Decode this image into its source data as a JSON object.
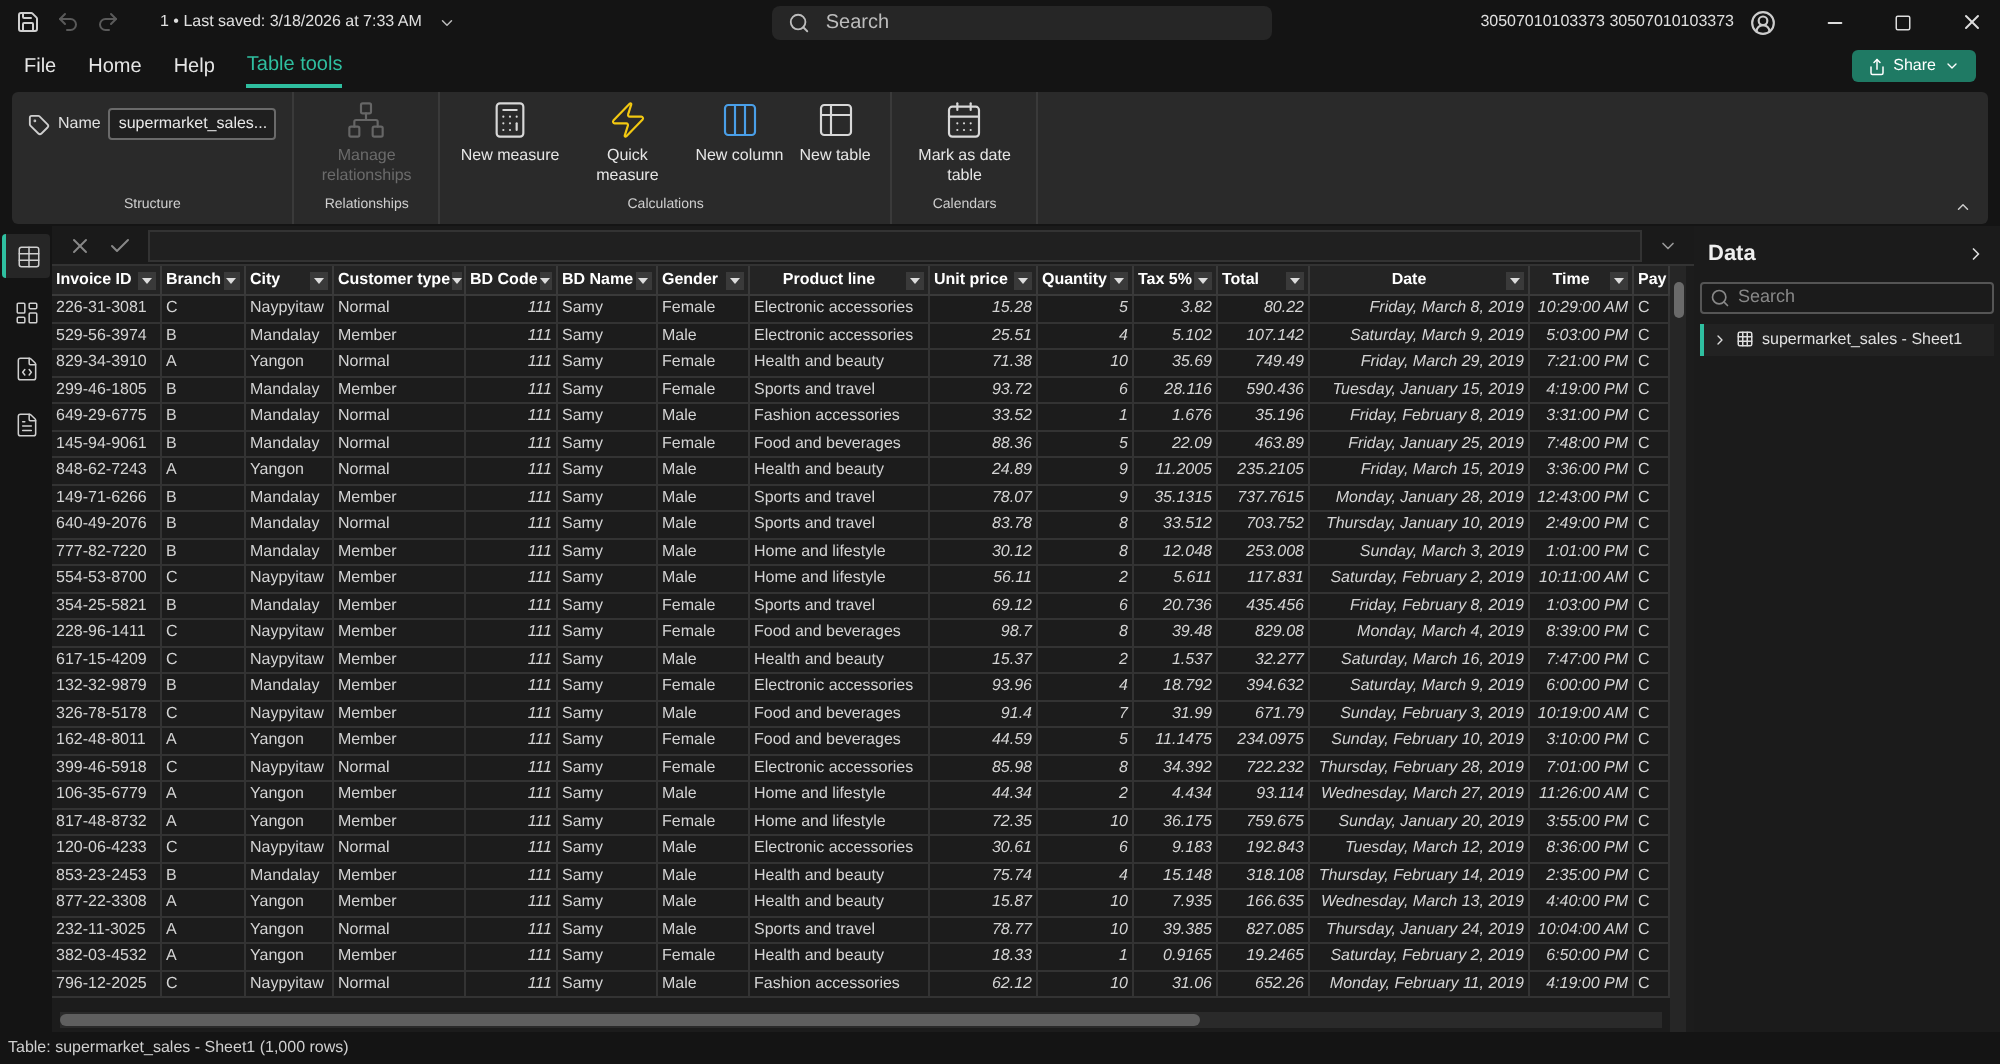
{
  "title_bar": {
    "title": "1 • Last saved: 3/18/2026 at 7:33 AM",
    "search": {
      "placeholder": "Search"
    },
    "user": "30507010103373 30507010103373",
    "quick_access": [
      {
        "disabled": false
      },
      {
        "disabled": true
      },
      {
        "disabled": true
      }
    ]
  },
  "menu": [
    {
      "label": "File",
      "selected": false
    },
    {
      "label": "Home",
      "selected": false
    },
    {
      "label": "Help",
      "selected": false
    },
    {
      "label": "Table tools",
      "selected": true
    }
  ],
  "share_button": "Share",
  "ribbon": {
    "groups": [
      {
        "label": "Structure",
        "name_field": {
          "label": "Name",
          "value": "supermarket_sales..."
        }
      },
      {
        "label": "Relationships",
        "buttons": [
          {
            "label": "Manage relationships",
            "disabled": true
          }
        ]
      },
      {
        "label": "Calculations",
        "buttons": [
          {
            "label": "New measure",
            "disabled": false
          },
          {
            "label": "Quick measure",
            "disabled": false
          },
          {
            "label": "New column",
            "disabled": false
          },
          {
            "label": "New table",
            "disabled": false
          }
        ]
      },
      {
        "label": "Calendars",
        "buttons": [
          {
            "label": "Mark as date table",
            "disabled": false
          }
        ]
      }
    ]
  },
  "view_rail": [
    {
      "selected": true
    },
    {
      "selected": false
    },
    {
      "selected": false
    },
    {
      "selected": false
    }
  ],
  "table": {
    "columns": [
      {
        "label": "Invoice ID",
        "kind": "text"
      },
      {
        "label": "Branch",
        "kind": "text"
      },
      {
        "label": "City",
        "kind": "text"
      },
      {
        "label": "Customer type",
        "kind": "text"
      },
      {
        "label": "BD Code",
        "kind": "number"
      },
      {
        "label": "BD Name",
        "kind": "text"
      },
      {
        "label": "Gender",
        "kind": "text"
      },
      {
        "label": "Product line",
        "kind": "text"
      },
      {
        "label": "Unit price",
        "kind": "number"
      },
      {
        "label": "Quantity",
        "kind": "number"
      },
      {
        "label": "Tax 5%",
        "kind": "number"
      },
      {
        "label": "Total",
        "kind": "number"
      },
      {
        "label": "Date",
        "kind": "number"
      },
      {
        "label": "Time",
        "kind": "number"
      },
      {
        "label": "Pay",
        "kind": "cut"
      }
    ],
    "rows": [
      [
        "226-31-3081",
        "C",
        "Naypyitaw",
        "Normal",
        "111",
        "Samy",
        "Female",
        "Electronic accessories",
        "15.28",
        "5",
        "3.82",
        "80.22",
        "Friday, March 8, 2019",
        "10:29:00 AM",
        "C"
      ],
      [
        "529-56-3974",
        "B",
        "Mandalay",
        "Member",
        "111",
        "Samy",
        "Male",
        "Electronic accessories",
        "25.51",
        "4",
        "5.102",
        "107.142",
        "Saturday, March 9, 2019",
        "5:03:00 PM",
        "C"
      ],
      [
        "829-34-3910",
        "A",
        "Yangon",
        "Normal",
        "111",
        "Samy",
        "Female",
        "Health and beauty",
        "71.38",
        "10",
        "35.69",
        "749.49",
        "Friday, March 29, 2019",
        "7:21:00 PM",
        "C"
      ],
      [
        "299-46-1805",
        "B",
        "Mandalay",
        "Member",
        "111",
        "Samy",
        "Female",
        "Sports and travel",
        "93.72",
        "6",
        "28.116",
        "590.436",
        "Tuesday, January 15, 2019",
        "4:19:00 PM",
        "C"
      ],
      [
        "649-29-6775",
        "B",
        "Mandalay",
        "Normal",
        "111",
        "Samy",
        "Male",
        "Fashion accessories",
        "33.52",
        "1",
        "1.676",
        "35.196",
        "Friday, February 8, 2019",
        "3:31:00 PM",
        "C"
      ],
      [
        "145-94-9061",
        "B",
        "Mandalay",
        "Normal",
        "111",
        "Samy",
        "Female",
        "Food and beverages",
        "88.36",
        "5",
        "22.09",
        "463.89",
        "Friday, January 25, 2019",
        "7:48:00 PM",
        "C"
      ],
      [
        "848-62-7243",
        "A",
        "Yangon",
        "Normal",
        "111",
        "Samy",
        "Male",
        "Health and beauty",
        "24.89",
        "9",
        "11.2005",
        "235.2105",
        "Friday, March 15, 2019",
        "3:36:00 PM",
        "C"
      ],
      [
        "149-71-6266",
        "B",
        "Mandalay",
        "Member",
        "111",
        "Samy",
        "Male",
        "Sports and travel",
        "78.07",
        "9",
        "35.1315",
        "737.7615",
        "Monday, January 28, 2019",
        "12:43:00 PM",
        "C"
      ],
      [
        "640-49-2076",
        "B",
        "Mandalay",
        "Normal",
        "111",
        "Samy",
        "Male",
        "Sports and travel",
        "83.78",
        "8",
        "33.512",
        "703.752",
        "Thursday, January 10, 2019",
        "2:49:00 PM",
        "C"
      ],
      [
        "777-82-7220",
        "B",
        "Mandalay",
        "Member",
        "111",
        "Samy",
        "Male",
        "Home and lifestyle",
        "30.12",
        "8",
        "12.048",
        "253.008",
        "Sunday, March 3, 2019",
        "1:01:00 PM",
        "C"
      ],
      [
        "554-53-8700",
        "C",
        "Naypyitaw",
        "Member",
        "111",
        "Samy",
        "Male",
        "Home and lifestyle",
        "56.11",
        "2",
        "5.611",
        "117.831",
        "Saturday, February 2, 2019",
        "10:11:00 AM",
        "C"
      ],
      [
        "354-25-5821",
        "B",
        "Mandalay",
        "Member",
        "111",
        "Samy",
        "Female",
        "Sports and travel",
        "69.12",
        "6",
        "20.736",
        "435.456",
        "Friday, February 8, 2019",
        "1:03:00 PM",
        "C"
      ],
      [
        "228-96-1411",
        "C",
        "Naypyitaw",
        "Member",
        "111",
        "Samy",
        "Female",
        "Food and beverages",
        "98.7",
        "8",
        "39.48",
        "829.08",
        "Monday, March 4, 2019",
        "8:39:00 PM",
        "C"
      ],
      [
        "617-15-4209",
        "C",
        "Naypyitaw",
        "Member",
        "111",
        "Samy",
        "Male",
        "Health and beauty",
        "15.37",
        "2",
        "1.537",
        "32.277",
        "Saturday, March 16, 2019",
        "7:47:00 PM",
        "C"
      ],
      [
        "132-32-9879",
        "B",
        "Mandalay",
        "Member",
        "111",
        "Samy",
        "Female",
        "Electronic accessories",
        "93.96",
        "4",
        "18.792",
        "394.632",
        "Saturday, March 9, 2019",
        "6:00:00 PM",
        "C"
      ],
      [
        "326-78-5178",
        "C",
        "Naypyitaw",
        "Member",
        "111",
        "Samy",
        "Male",
        "Food and beverages",
        "91.4",
        "7",
        "31.99",
        "671.79",
        "Sunday, February 3, 2019",
        "10:19:00 AM",
        "C"
      ],
      [
        "162-48-8011",
        "A",
        "Yangon",
        "Member",
        "111",
        "Samy",
        "Female",
        "Food and beverages",
        "44.59",
        "5",
        "11.1475",
        "234.0975",
        "Sunday, February 10, 2019",
        "3:10:00 PM",
        "C"
      ],
      [
        "399-46-5918",
        "C",
        "Naypyitaw",
        "Normal",
        "111",
        "Samy",
        "Female",
        "Electronic accessories",
        "85.98",
        "8",
        "34.392",
        "722.232",
        "Thursday, February 28, 2019",
        "7:01:00 PM",
        "C"
      ],
      [
        "106-35-6779",
        "A",
        "Yangon",
        "Member",
        "111",
        "Samy",
        "Male",
        "Home and lifestyle",
        "44.34",
        "2",
        "4.434",
        "93.114",
        "Wednesday, March 27, 2019",
        "11:26:00 AM",
        "C"
      ],
      [
        "817-48-8732",
        "A",
        "Yangon",
        "Member",
        "111",
        "Samy",
        "Female",
        "Home and lifestyle",
        "72.35",
        "10",
        "36.175",
        "759.675",
        "Sunday, January 20, 2019",
        "3:55:00 PM",
        "C"
      ],
      [
        "120-06-4233",
        "C",
        "Naypyitaw",
        "Normal",
        "111",
        "Samy",
        "Male",
        "Electronic accessories",
        "30.61",
        "6",
        "9.183",
        "192.843",
        "Tuesday, March 12, 2019",
        "8:36:00 PM",
        "C"
      ],
      [
        "853-23-2453",
        "B",
        "Mandalay",
        "Member",
        "111",
        "Samy",
        "Male",
        "Health and beauty",
        "75.74",
        "4",
        "15.148",
        "318.108",
        "Thursday, February 14, 2019",
        "2:35:00 PM",
        "C"
      ],
      [
        "877-22-3308",
        "A",
        "Yangon",
        "Member",
        "111",
        "Samy",
        "Male",
        "Health and beauty",
        "15.87",
        "10",
        "7.935",
        "166.635",
        "Wednesday, March 13, 2019",
        "4:40:00 PM",
        "C"
      ],
      [
        "232-11-3025",
        "A",
        "Yangon",
        "Normal",
        "111",
        "Samy",
        "Male",
        "Sports and travel",
        "78.77",
        "10",
        "39.385",
        "827.085",
        "Thursday, January 24, 2019",
        "10:04:00 AM",
        "C"
      ],
      [
        "382-03-4532",
        "A",
        "Yangon",
        "Member",
        "111",
        "Samy",
        "Female",
        "Health and beauty",
        "18.33",
        "1",
        "0.9165",
        "19.2465",
        "Saturday, February 2, 2019",
        "6:50:00 PM",
        "C"
      ],
      [
        "796-12-2025",
        "C",
        "Naypyitaw",
        "Normal",
        "111",
        "Samy",
        "Male",
        "Fashion accessories",
        "62.12",
        "10",
        "31.06",
        "652.26",
        "Monday, February 11, 2019",
        "4:19:00 PM",
        "C"
      ]
    ]
  },
  "data_pane": {
    "title": "Data",
    "search": {
      "placeholder": "Search"
    },
    "items": [
      {
        "label": "supermarket_sales - Sheet1",
        "selected": true,
        "expanded": false
      }
    ]
  },
  "status_bar": "Table: supermarket_sales - Sheet1 (1,000 rows)"
}
